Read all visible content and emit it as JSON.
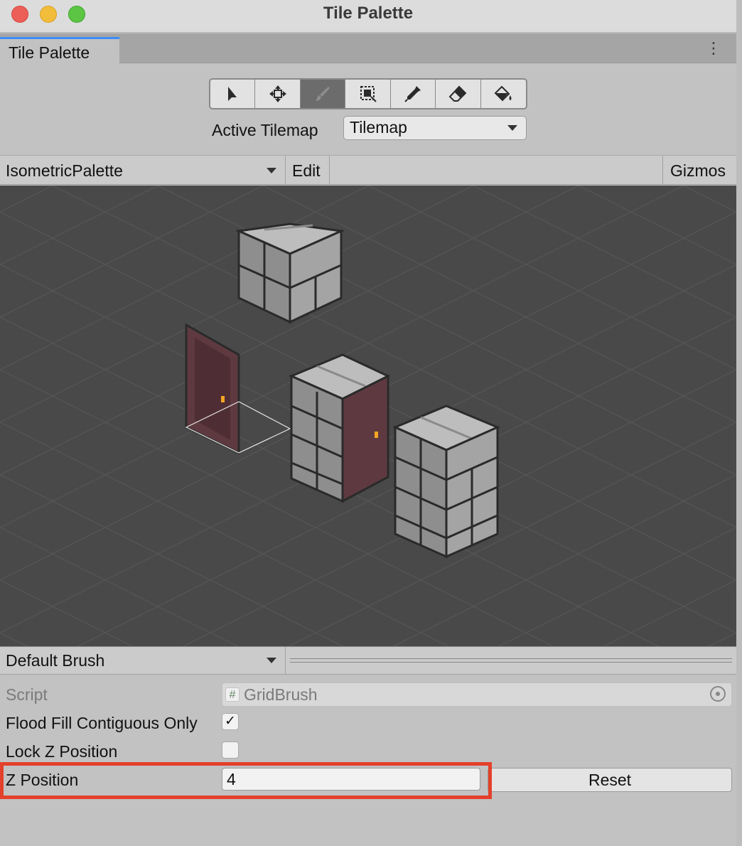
{
  "window": {
    "title": "Tile Palette",
    "controls": [
      "close",
      "minimize",
      "zoom"
    ]
  },
  "tab": {
    "label": "Tile Palette",
    "menu_icon": "kebab-menu-icon"
  },
  "toolbar": {
    "tools": [
      {
        "name": "select",
        "icon": "arrow-pointer-icon",
        "active": false
      },
      {
        "name": "move",
        "icon": "move-arrows-icon",
        "active": false
      },
      {
        "name": "paint",
        "icon": "brush-icon",
        "active": true
      },
      {
        "name": "box-fill",
        "icon": "box-fill-icon",
        "active": false
      },
      {
        "name": "pick",
        "icon": "eyedropper-icon",
        "active": false
      },
      {
        "name": "erase",
        "icon": "eraser-icon",
        "active": false
      },
      {
        "name": "fill",
        "icon": "paint-bucket-icon",
        "active": false
      }
    ]
  },
  "active_tilemap": {
    "label": "Active Tilemap",
    "value": "Tilemap"
  },
  "palette_bar": {
    "palette": "IsometricPalette",
    "edit": "Edit",
    "gizmos": "Gizmos"
  },
  "brush": {
    "selected": "Default Brush"
  },
  "properties": {
    "script_label": "Script",
    "script_value": "GridBrush",
    "flood_fill_label": "Flood Fill Contiguous Only",
    "flood_fill_checked": true,
    "flood_fill_mark": "✓",
    "lock_z_label": "Lock Z Position",
    "lock_z_checked": false,
    "z_position_label": "Z Position",
    "z_position_value": "4",
    "reset_label": "Reset"
  },
  "colors": {
    "highlight": "#e4402b",
    "tab_accent": "#3c8ef7",
    "canvas_bg": "#494949"
  }
}
